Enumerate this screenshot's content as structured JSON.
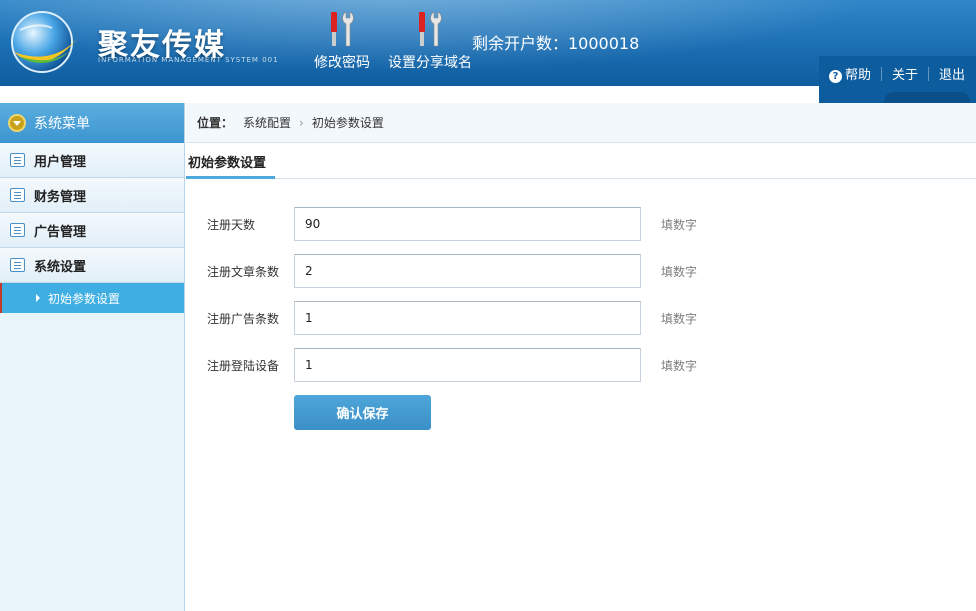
{
  "header": {
    "brand": "聚友传媒",
    "brand_sub": "INFORMATION MANAGEMENT SYSTEM 001",
    "tools": [
      {
        "label": "修改密码",
        "icon": "tools-icon"
      },
      {
        "label": "设置分享域名",
        "icon": "tools-icon"
      }
    ],
    "remain": "剩余开户数：1000018",
    "nav": {
      "help": "帮助",
      "about": "关于",
      "logout": "退出"
    }
  },
  "sidebar": {
    "title": "系统菜单",
    "items": [
      {
        "label": "用户管理"
      },
      {
        "label": "财务管理"
      },
      {
        "label": "广告管理"
      },
      {
        "label": "系统设置"
      }
    ],
    "active_sub": "初始参数设置"
  },
  "breadcrumb": {
    "label": "位置：",
    "items": [
      "系统配置",
      "初始参数设置"
    ]
  },
  "tab": {
    "label": "初始参数设置"
  },
  "form": {
    "fields": [
      {
        "label": "注册天数",
        "value": "90",
        "hint": "填数字"
      },
      {
        "label": "注册文章条数",
        "value": "2",
        "hint": "填数字"
      },
      {
        "label": "注册广告条数",
        "value": "1",
        "hint": "填数字"
      },
      {
        "label": "注册登陆设备",
        "value": "1",
        "hint": "填数字"
      }
    ],
    "submit_label": "确认保存"
  },
  "colors": {
    "header": "#1b6eb3",
    "accent": "#3eaee3",
    "button": "#3a8fc7"
  }
}
